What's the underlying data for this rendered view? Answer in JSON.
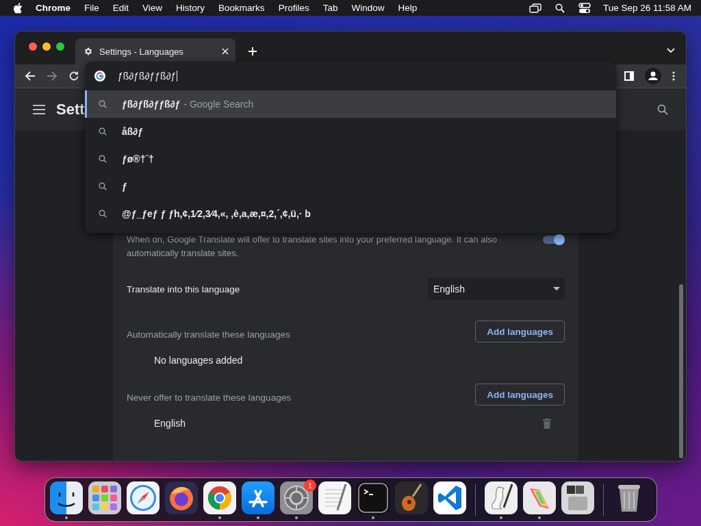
{
  "menu_bar": {
    "app": "Chrome",
    "menus": [
      "File",
      "Edit",
      "View",
      "History",
      "Bookmarks",
      "Profiles",
      "Tab",
      "Window",
      "Help"
    ],
    "clock": "Tue Sep 26  11:58 AM"
  },
  "browser": {
    "tab": {
      "title": "Settings - Languages",
      "selected": true
    },
    "omnibox": {
      "value": "ƒß∂ƒß∂ƒƒß∂ƒ"
    },
    "suggestions": [
      {
        "text": "ƒß∂ƒß∂ƒƒß∂ƒ",
        "suffix": "- Google Search",
        "selected": true
      },
      {
        "text": "åß∂ƒ",
        "selected": false
      },
      {
        "text": "ƒø®†¨†",
        "selected": false
      },
      {
        "text": "ƒ",
        "selected": false
      },
      {
        "text": "@ƒ_ƒeƒ ƒ ƒh,¢,1⁄2,3⁄4,«, ,è,a,æ,¤,2,´,¢,ü,· b",
        "selected": false
      }
    ],
    "page_title": "Sett",
    "translate": {
      "description": "When on, Google Translate will offer to translate sites into your preferred language. It can also automatically translate sites.",
      "on": true
    },
    "target_language": {
      "label": "Translate into this language",
      "value": "English"
    },
    "sections": [
      {
        "label": "Automatically translate these languages",
        "button": "Add languages",
        "items": [
          {
            "text": "No languages added",
            "kind": "empty"
          }
        ]
      },
      {
        "label": "Never offer to translate these languages",
        "button": "Add languages",
        "items": [
          {
            "text": "English",
            "kind": "language"
          }
        ]
      }
    ]
  },
  "dock": [
    {
      "kind": "finder",
      "running": true
    },
    {
      "kind": "launchpad",
      "running": false
    },
    {
      "kind": "safari",
      "running": false
    },
    {
      "kind": "firefox",
      "running": false
    },
    {
      "kind": "chrome",
      "running": true
    },
    {
      "kind": "appstore",
      "running": true
    },
    {
      "kind": "settings",
      "running": true,
      "badge": "1"
    },
    {
      "kind": "textedit",
      "running": false
    },
    {
      "kind": "terminal",
      "running": true
    },
    {
      "kind": "garageband",
      "running": false
    },
    {
      "kind": "vscode",
      "running": false
    },
    {
      "kind": "divider"
    },
    {
      "kind": "scripteditor",
      "running": true
    },
    {
      "kind": "grapher",
      "running": true
    },
    {
      "kind": "bootcamp",
      "running": false
    },
    {
      "kind": "divider"
    },
    {
      "kind": "trash",
      "running": false
    }
  ]
}
